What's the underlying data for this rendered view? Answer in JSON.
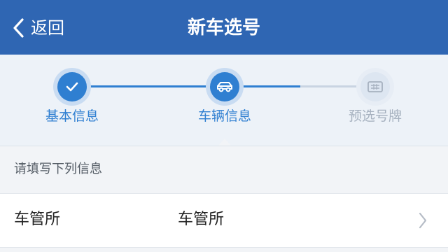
{
  "header": {
    "back_label": "返回",
    "title": "新车选号",
    "background": "#2f66b3"
  },
  "steps": [
    {
      "label": "基本信息",
      "state": "done",
      "icon": "check-icon"
    },
    {
      "label": "车辆信息",
      "state": "current",
      "icon": "car-icon"
    },
    {
      "label": "预选号牌",
      "state": "pending",
      "icon": "license-plate-icon"
    }
  ],
  "form": {
    "section_label": "请填写下列信息",
    "fields": [
      {
        "name": "车管所",
        "value": "车管所",
        "icon": "chevron-right-icon"
      }
    ]
  },
  "colors": {
    "accent": "#2f7fd1",
    "pending": "#a6b1bf"
  }
}
